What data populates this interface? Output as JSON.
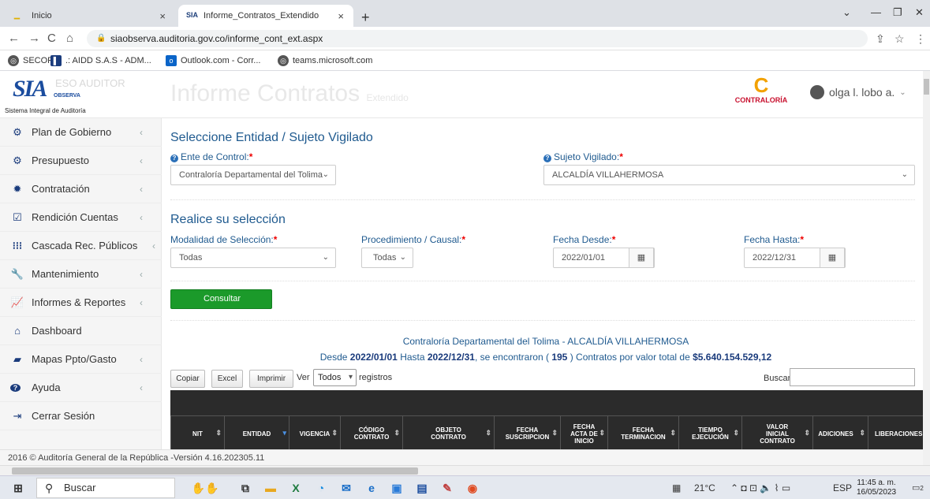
{
  "browser": {
    "tabs": [
      {
        "label": "Inicio",
        "close": "×"
      },
      {
        "label": "Informe_Contratos_Extendido",
        "close": "×"
      }
    ],
    "new_tab": "+",
    "url": "siaobserva.auditoria.gov.co/informe_cont_ext.aspx",
    "bookmarks": [
      "SECOP",
      ".: AIDD S.A.S - ADM...",
      "Outlook.com - Corr...",
      "teams.microsoft.com"
    ]
  },
  "header": {
    "logo_text": "SIA",
    "logo_sub": "OBSERVA",
    "logo_caption": "Sistema Integral de Auditoría",
    "logo_faded": "ESO AUDITOR",
    "page_title": "Informe Contratos",
    "page_title_suffix": "Extendido",
    "contraloria": "CONTRALORÍA",
    "user": "olga l. lobo a.",
    "user_caret": "⌄"
  },
  "sidebar": {
    "items": [
      {
        "label": "Plan de Gobierno",
        "icon": "cogs-icon",
        "glyph": "⚙"
      },
      {
        "label": "Presupuesto",
        "icon": "cogs-icon",
        "glyph": "⚙"
      },
      {
        "label": "Contratación",
        "icon": "badge-icon",
        "glyph": "✹"
      },
      {
        "label": "Rendición Cuentas",
        "icon": "check-square-icon",
        "glyph": "☑"
      },
      {
        "label": "Cascada Rec. Públicos",
        "icon": "grid-icon",
        "glyph": "⁝⁝⁝"
      },
      {
        "label": "Mantenimiento",
        "icon": "wrench-icon",
        "glyph": "🔧"
      },
      {
        "label": "Informes & Reportes",
        "icon": "chart-icon",
        "glyph": "📈"
      },
      {
        "label": "Dashboard",
        "icon": "home-icon",
        "glyph": "⌂"
      },
      {
        "label": "Mapas Ppto/Gasto",
        "icon": "book-icon",
        "glyph": "▰"
      },
      {
        "label": "Ayuda",
        "icon": "question-icon",
        "glyph": "?"
      },
      {
        "label": "Cerrar Sesión",
        "icon": "logout-icon",
        "glyph": "⇥"
      }
    ]
  },
  "form": {
    "section1_title": "Seleccione Entidad / Sujeto Vigilado",
    "ente_label": "Ente de Control:",
    "ente_value": "Contraloría Departamental del Tolima",
    "sujeto_label": "Sujeto Vigilado:",
    "sujeto_value": "ALCALDÍA VILLAHERMOSA",
    "section2_title": "Realice su selección",
    "modalidad_label": "Modalidad de Selección:",
    "modalidad_value": "Todas",
    "procedimiento_label": "Procedimiento / Causal:",
    "procedimiento_value": "Todas",
    "desde_label": "Fecha Desde:",
    "desde_value": "2022/01/01",
    "hasta_label": "Fecha Hasta:",
    "hasta_value": "2022/12/31",
    "consultar": "Consultar",
    "required_mark": "*"
  },
  "results": {
    "line1": "Contraloría Departamental del Tolima - ALCALDÍA VILLAHERMOSA",
    "line2_prefix": "Desde ",
    "line2_from": "2022/01/01",
    "line2_mid": " Hasta ",
    "line2_to": "2022/12/31",
    "line2_found": ", se encontraron ( ",
    "line2_count": "195",
    "line2_contracts": " ) Contratos por valor total de ",
    "line2_total": "$5.640.154.529,12"
  },
  "toolbar": {
    "copy": "Copiar",
    "excel": "Excel",
    "print": "Imprimir",
    "ver": "Ver",
    "page_len": "Todos",
    "registros": "registros",
    "search_label": "Buscar"
  },
  "table": {
    "columns": [
      "NIT",
      "ENTIDAD",
      "VIGENCIA",
      "CÓDIGO CONTRATO",
      "OBJETO CONTRATO",
      "FECHA SUSCRIPCION",
      "FECHA ACTA DE INICIO",
      "FECHA TERMINACION",
      "TIEMPO EJECUCIÓN",
      "VALOR INICIAL CONTRATO",
      "ADICIONES",
      "LIBERACIONES"
    ]
  },
  "footer": "2016 © Auditoría General de la República -Versión 4.16.202305.11",
  "taskbar": {
    "search": "Buscar",
    "temperature": "21°C",
    "lang": "ESP",
    "time": "11:45 a. m.",
    "date": "16/05/2023",
    "notif": "2"
  }
}
